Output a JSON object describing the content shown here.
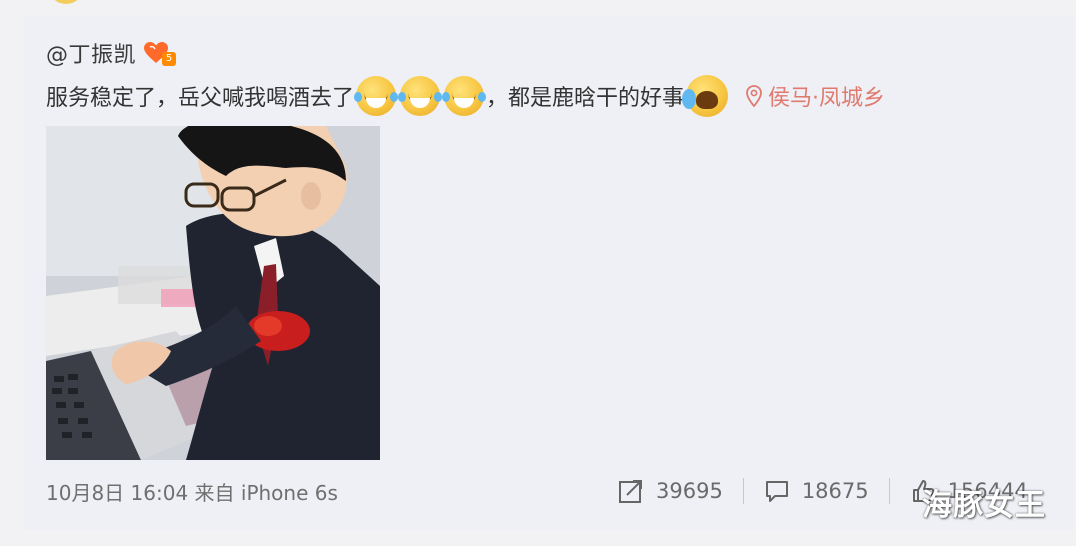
{
  "post": {
    "username": "@丁振凯",
    "level_badge": "5",
    "text_part1": "服务稳定了，岳父喊我喝酒去了",
    "text_part2": "，都是鹿晗干的好事",
    "emoji_laugh": "laugh-cry-emoji",
    "emoji_cry": "crying-emoji",
    "location": "侯马·凤城乡",
    "photo_alt": "man-in-suit-typing-photo"
  },
  "footer": {
    "meta": "10月8日 16:04 来自 iPhone 6s",
    "repost_count": "39695",
    "comment_count": "18675",
    "like_count": "156444"
  },
  "watermark": "海豚女王",
  "colors": {
    "background": "#f2f2f5",
    "card": "#eef0f6",
    "location": "#e07a6e",
    "text": "#333333",
    "meta": "#6f6f6f",
    "badge_level": "#ff8a00"
  }
}
